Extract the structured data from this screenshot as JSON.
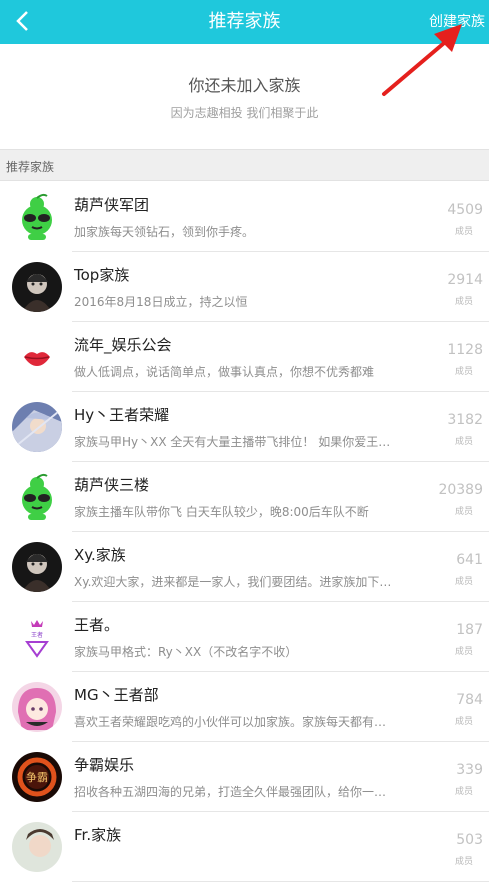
{
  "header": {
    "title": "推荐家族",
    "create_label": "创建家族",
    "accent": "#1fc8dc"
  },
  "hero": {
    "title": "你还未加入家族",
    "subtitle": "因为志趣相投 我们相聚于此"
  },
  "section_label": "推荐家族",
  "families": [
    {
      "name": "葫芦侠军团",
      "desc": "加家族每天领钻石，领到你手疼。",
      "count": "4509",
      "unit": "成员",
      "avatar": "gourd-mascot-icon"
    },
    {
      "name": "Top家族",
      "desc": "2016年8月18日成立，持之以恒",
      "count": "2914",
      "unit": "成员",
      "avatar": "dark-portrait-avatar"
    },
    {
      "name": "流年_娱乐公会",
      "desc": "做人低调点，说话简单点，做事认真点，你想不优秀都难",
      "count": "1128",
      "unit": "成员",
      "avatar": "lips-icon"
    },
    {
      "name": "Hy丶王者荣耀",
      "desc": "家族马甲Hy丶XX 全天有大量主播带飞排位！ 如果你爱王…",
      "count": "3182",
      "unit": "成员",
      "avatar": "warrior-avatar"
    },
    {
      "name": "葫芦侠三楼",
      "desc": "家族主播车队带你飞 白天车队较少，晚8:00后车队不断",
      "count": "20389",
      "unit": "成员",
      "avatar": "gourd-mascot-icon"
    },
    {
      "name": "Xy.家族",
      "desc": "Xy.欢迎大家，进来都是一家人，我们要团结。进家族加下…",
      "count": "641",
      "unit": "成员",
      "avatar": "dark-portrait-avatar"
    },
    {
      "name": "王者。",
      "desc": "家族马甲格式：Ry丶XX（不改名字不收）",
      "count": "187",
      "unit": "成员",
      "avatar": "crown-triangle-logo"
    },
    {
      "name": "MG丶王者部",
      "desc": "喜欢王者荣耀跟吃鸡的小伙伴可以加家族。家族每天都有…",
      "count": "784",
      "unit": "成员",
      "avatar": "anime-girl-avatar"
    },
    {
      "name": "争霸娱乐",
      "desc": "招收各种五湖四海的兄弟，打造全久伴最强团队，给你一…",
      "count": "339",
      "unit": "成员",
      "avatar": "fire-ring-avatar"
    },
    {
      "name": "Fr.家族",
      "desc": "",
      "count": "503",
      "unit": "成员",
      "avatar": "photo-avatar"
    }
  ]
}
